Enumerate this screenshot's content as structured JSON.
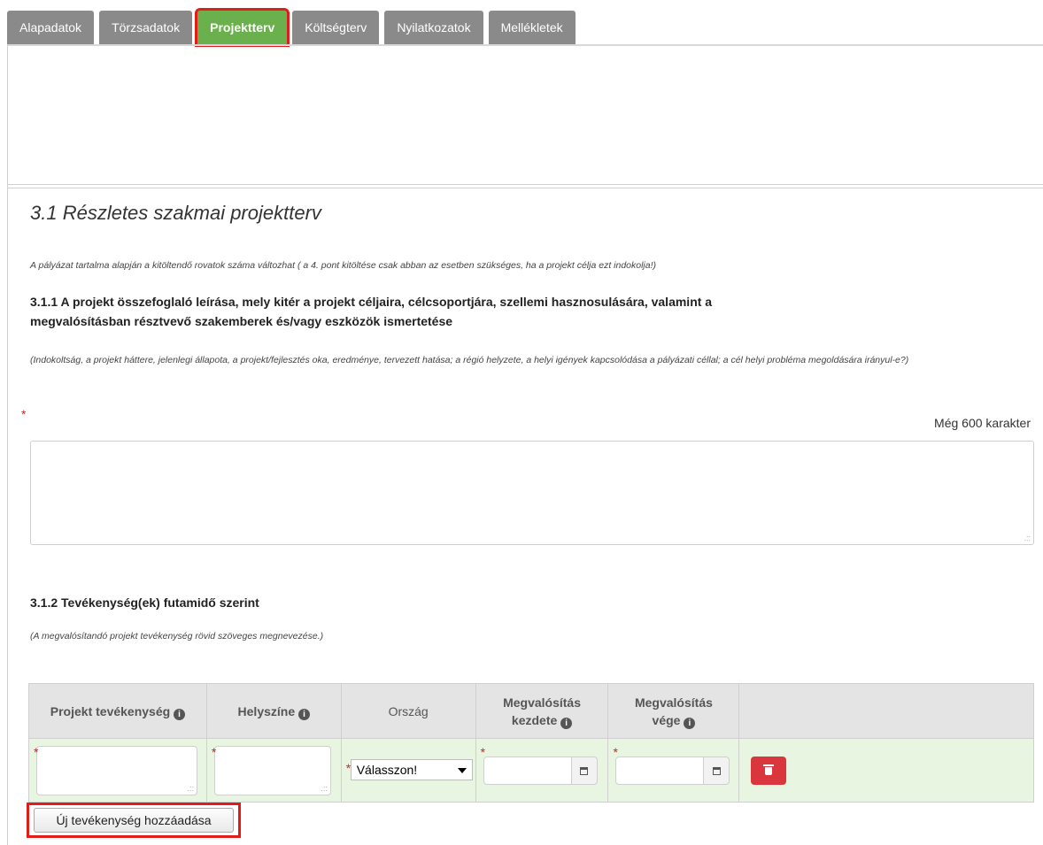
{
  "tabs": [
    {
      "label": "Alapadatok"
    },
    {
      "label": "Törzsadatok"
    },
    {
      "label": "Projektterv"
    },
    {
      "label": "Költségterv"
    },
    {
      "label": "Nyilatkozatok"
    },
    {
      "label": "Mellékletek"
    }
  ],
  "section": {
    "title": "3.1 Részletes szakmai projektterv",
    "note": "A pályázat tartalma alapján a kitöltendő rovatok száma változhat ( a 4. pont kitöltése csak abban az esetben szükséges, ha a projekt célja ezt indokolja!)"
  },
  "sub1": {
    "heading": "3.1.1 A projekt összefoglaló leírása, mely kitér a projekt céljaira, célcsoportjára, szellemi hasznosulására, valamint a megvalósításban résztvevő szakemberek és/vagy eszközök ismertetése",
    "note": "(Indokoltság, a projekt háttere, jelenlegi állapota, a projekt/fejlesztés oka, eredménye, tervezett hatása; a régió helyzete, a helyi igények kapcsolódása a pályázati céllal; a cél helyi probléma megoldására irányul-e?)",
    "required_mark": "*",
    "char_count": "Még 600 karakter",
    "value": ""
  },
  "sub2": {
    "heading": "3.1.2 Tevékenység(ek) futamidő szerint",
    "note": "(A megvalósítandó projekt tevékenység rövid szöveges megnevezése.)"
  },
  "table": {
    "headers": {
      "activity": "Projekt tevékenység",
      "location": "Helyszíne",
      "country": "Ország",
      "start_line1": "Megvalósítás",
      "start_line2": "kezdete",
      "end_line1": "Megvalósítás",
      "end_line2": "vége"
    },
    "row": {
      "activity": "",
      "location": "",
      "country_selected": "Válasszon!",
      "start_date": "",
      "end_date": ""
    }
  },
  "icons": {
    "info": "info-icon",
    "calendar": "calendar-icon",
    "delete": "trash-icon"
  },
  "add_button": "Új tevékenység hozzáadása",
  "colors": {
    "tab_default": "#8a8a8a",
    "tab_active": "#6ab04c",
    "highlight": "#e21b1b",
    "row_bg": "#e8f5e1",
    "delete_button": "#d9363e"
  }
}
